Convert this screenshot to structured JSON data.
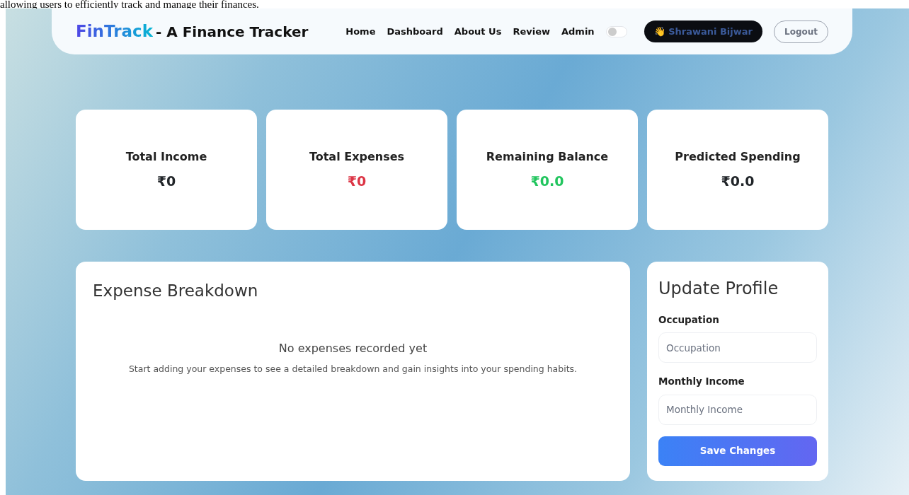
{
  "document_text": "allowing users to efficiently track and manage their finances.",
  "navbar": {
    "brand": "FinTrack",
    "brand_suffix": "- A Finance Tracker",
    "links": [
      {
        "label": "Home"
      },
      {
        "label": "Dashboard"
      },
      {
        "label": "About Us"
      },
      {
        "label": "Review"
      },
      {
        "label": "Admin"
      }
    ],
    "theme_toggle": {
      "on": false
    },
    "user": {
      "emoji": "👋",
      "name": "Shrawani Bijwar"
    },
    "logout": "Logout"
  },
  "stats": [
    {
      "label": "Total Income",
      "value": "₹0",
      "color": "#212529"
    },
    {
      "label": "Total Expenses",
      "value": "₹0",
      "color": "#dc3545"
    },
    {
      "label": "Remaining Balance",
      "value": "₹0.0",
      "color": "#22c55e"
    },
    {
      "label": "Predicted Spending",
      "value": "₹0.0",
      "color": "#212529"
    }
  ],
  "breakdown": {
    "title": "Expense Breakdown",
    "empty_title": "No expenses recorded yet",
    "empty_text": "Start adding your expenses to see a detailed breakdown and gain insights into your spending habits."
  },
  "profile": {
    "title": "Update Profile",
    "fields": [
      {
        "label": "Occupation",
        "placeholder": "Occupation"
      },
      {
        "label": "Monthly Income",
        "placeholder": "Monthly Income"
      }
    ],
    "button": "Save Changes"
  }
}
